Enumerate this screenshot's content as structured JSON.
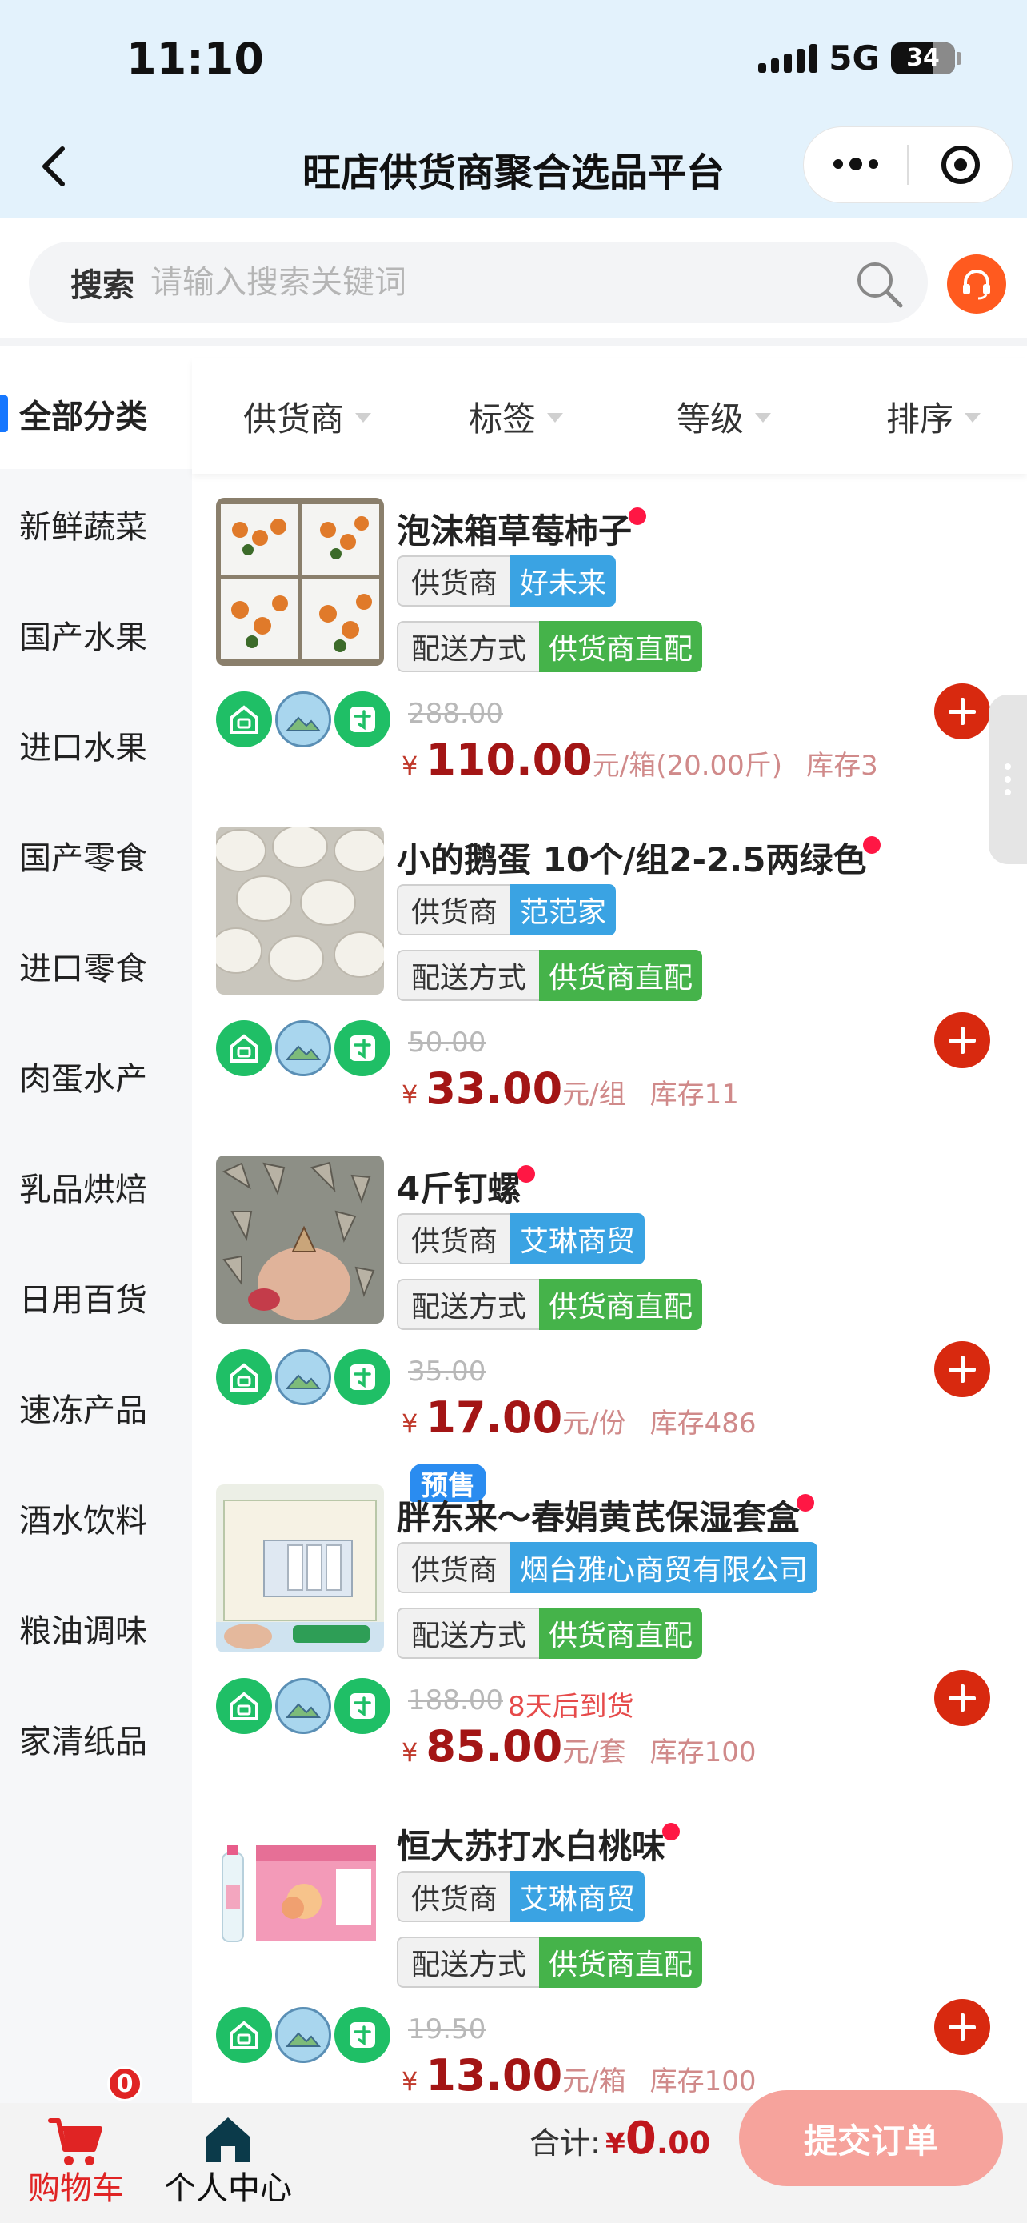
{
  "status": {
    "time": "11:10",
    "network": "5G",
    "battery": "34"
  },
  "nav": {
    "title": "旺店供货商聚合选品平台"
  },
  "search": {
    "label": "搜索",
    "placeholder": "请输入搜索关键词"
  },
  "sidebar": {
    "items": [
      {
        "label": "全部分类"
      },
      {
        "label": "新鲜蔬菜"
      },
      {
        "label": "国产水果"
      },
      {
        "label": "进口水果"
      },
      {
        "label": "国产零食"
      },
      {
        "label": "进口零食"
      },
      {
        "label": "肉蛋水产"
      },
      {
        "label": "乳品烘焙"
      },
      {
        "label": "日用百货"
      },
      {
        "label": "速冻产品"
      },
      {
        "label": "酒水饮料"
      },
      {
        "label": "粮油调味"
      },
      {
        "label": "家清纸品"
      }
    ]
  },
  "filters": {
    "supplier": "供货商",
    "tag": "标签",
    "level": "等级",
    "sort": "排序"
  },
  "labels": {
    "supplier": "供货商",
    "delivery": "配送方式",
    "yen": "¥"
  },
  "products": [
    {
      "name": "泡沫箱草莓柿子",
      "supplier": "好未来",
      "delivery": "供货商直配",
      "original_price": "288.00",
      "price": "110.00",
      "unit": "元/箱(20.00斤)",
      "stock": "库存3"
    },
    {
      "name": "小的鹅蛋 10个/组2-2.5两绿色",
      "supplier": "范范家",
      "delivery": "供货商直配",
      "original_price": "50.00",
      "price": "33.00",
      "unit": "元/组",
      "stock": "库存11"
    },
    {
      "name": "4斤钉螺",
      "supplier": "艾琳商贸",
      "delivery": "供货商直配",
      "original_price": "35.00",
      "price": "17.00",
      "unit": "元/份",
      "stock": "库存486"
    },
    {
      "name": "胖东来～春娟黄芪保湿套盒",
      "supplier": "烟台雅心商贸有限公司",
      "delivery": "供货商直配",
      "original_price": "188.00",
      "eta": "8天后到货",
      "presale": "预售",
      "price": "85.00",
      "unit": "元/套",
      "stock": "库存100"
    },
    {
      "name": "恒大苏打水白桃味",
      "supplier": "艾琳商贸",
      "delivery": "供货商直配",
      "original_price": "19.50",
      "price": "13.00",
      "unit": "元/箱",
      "stock": "库存100"
    }
  ],
  "bottom": {
    "cart_label": "购物车",
    "cart_count": "0",
    "profile_label": "个人中心",
    "total_label": "合计:",
    "total_yen": "¥",
    "total_int": "0",
    "total_dec": ".00",
    "submit_label": "提交订单"
  },
  "colors": {
    "accent": "#1677ff",
    "price": "#a31515",
    "supplier_tag": "#3aa3e3",
    "delivery_tag": "#45b34a",
    "add_button": "#d8290f",
    "submit": "#f6a39c"
  }
}
